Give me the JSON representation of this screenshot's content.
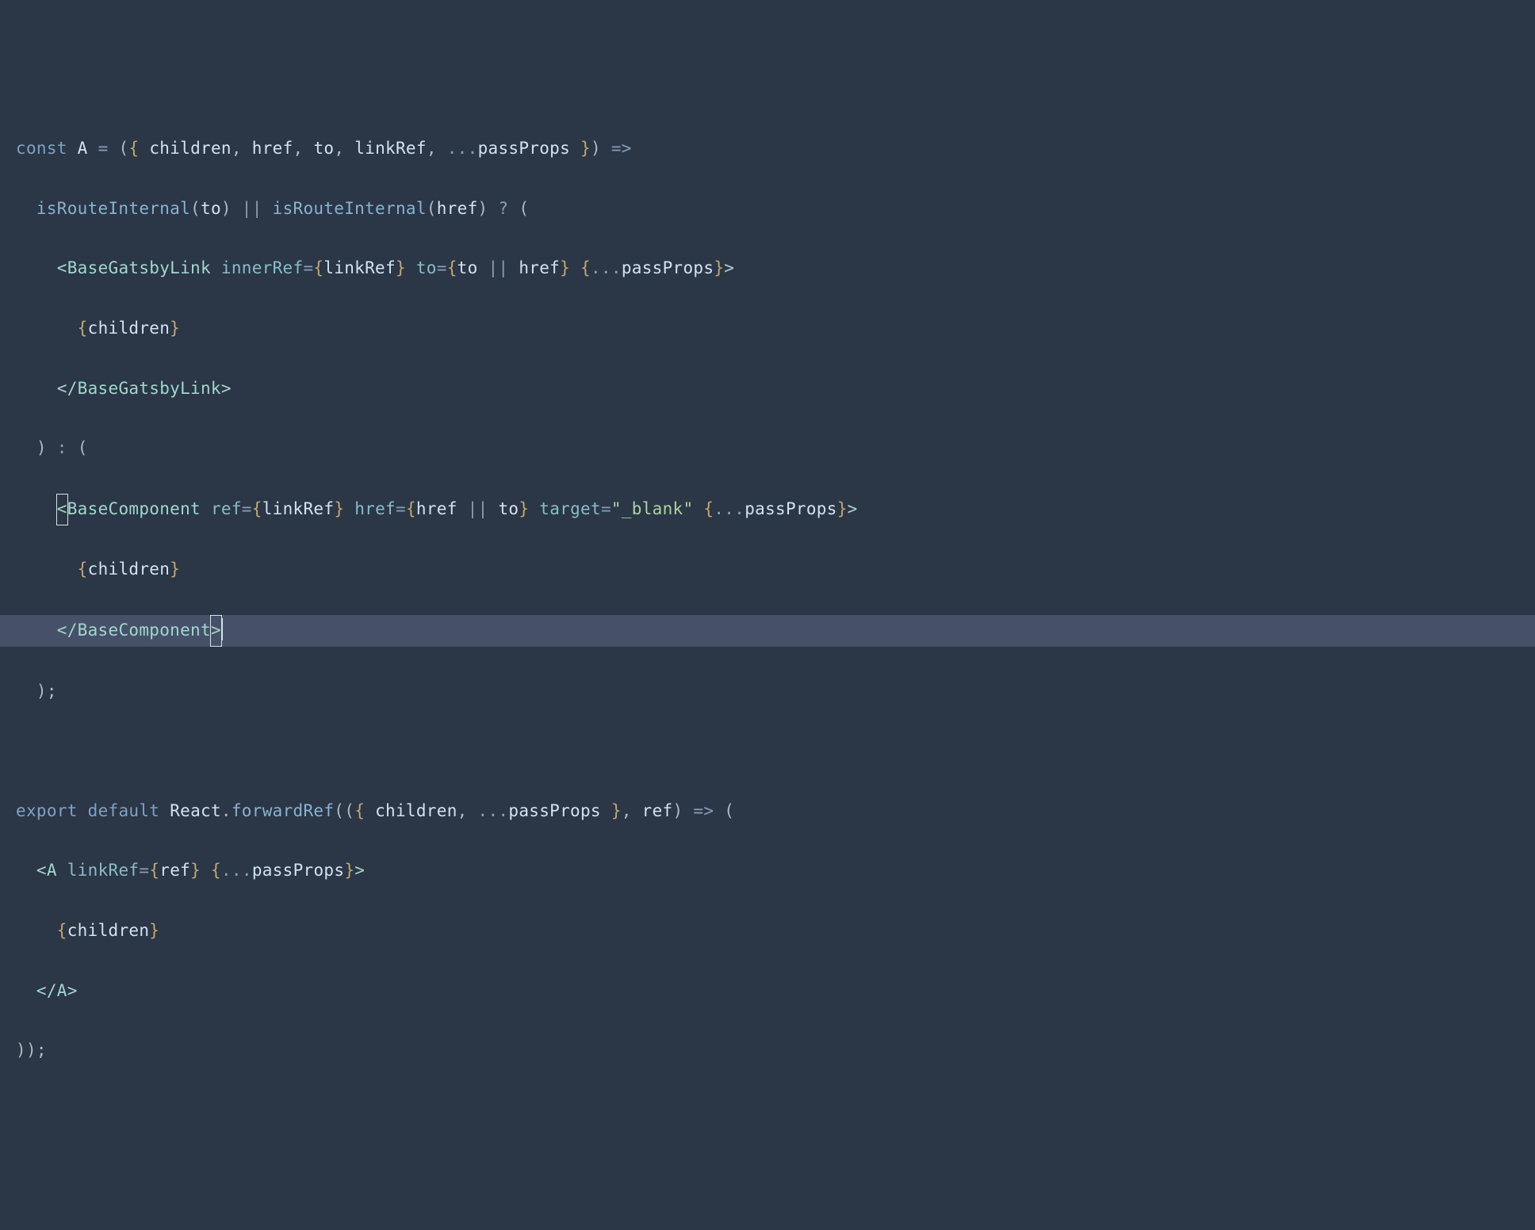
{
  "code": {
    "line1": {
      "kw_const": "const",
      "name_A": "A",
      "eq": "=",
      "oparen": "(",
      "obrace": "{ ",
      "p_children": "children",
      "comma1": ", ",
      "p_href": "href",
      "comma2": ", ",
      "p_to": "to",
      "comma3": ", ",
      "p_linkRef": "linkRef",
      "comma4": ", ",
      "spread": "...",
      "p_passProps": "passProps",
      "cbrace": " }",
      "cparen": ")",
      "arrow": " =>"
    },
    "line2": {
      "fn1": "isRouteInternal",
      "op": "(",
      "arg_to": "to",
      "cp": ")",
      "or": " || ",
      "fn2": "isRouteInternal",
      "op2": "(",
      "arg_href": "href",
      "cp2": ")",
      "tern_q": " ? ",
      "oparen": "("
    },
    "line3": {
      "lt": "<",
      "tag": "BaseGatsbyLink",
      "sp1": " ",
      "attr_innerRef": "innerRef",
      "eq1": "=",
      "ob1": "{",
      "val_linkRef": "linkRef",
      "cb1": "}",
      "sp2": " ",
      "attr_to": "to",
      "eq2": "=",
      "ob2": "{",
      "val_to": "to",
      "or": " || ",
      "val_href": "href",
      "cb2": "}",
      "sp3": " ",
      "ob3": "{",
      "spread": "...",
      "val_passProps": "passProps",
      "cb3": "}",
      "gt": ">"
    },
    "line4": {
      "ob": "{",
      "val": "children",
      "cb": "}"
    },
    "line5": {
      "lt": "</",
      "tag": "BaseGatsbyLink",
      "gt": ">"
    },
    "line6": {
      "cparen": ")",
      "colon": " : ",
      "oparen": "("
    },
    "line7": {
      "lt": "<",
      "tag": "BaseComponent",
      "sp1": " ",
      "attr_ref": "ref",
      "eq1": "=",
      "ob1": "{",
      "val_linkRef": "linkRef",
      "cb1": "}",
      "sp2": " ",
      "attr_href": "href",
      "eq2": "=",
      "ob2": "{",
      "val_href": "href",
      "or": " || ",
      "val_to": "to",
      "cb2": "}",
      "sp3": " ",
      "attr_target": "target",
      "eq3": "=",
      "str": "\"_blank\"",
      "sp4": " ",
      "ob3": "{",
      "spread": "...",
      "val_passProps": "passProps",
      "cb3": "}",
      "gt": ">"
    },
    "line8": {
      "ob": "{",
      "val": "children",
      "cb": "}"
    },
    "line9": {
      "lt": "</",
      "tag": "BaseComponent",
      "gt": ">"
    },
    "line10": {
      "cparen": ")",
      "semi": ";"
    },
    "line12": {
      "kw_export": "export",
      "sp1": " ",
      "kw_default": "default",
      "sp2": " ",
      "react": "React",
      "dot": ".",
      "forwardRef": "forwardRef",
      "op": "(",
      "op2": "(",
      "obrace": "{ ",
      "p_children": "children",
      "comma": ", ",
      "spread": "...",
      "p_passProps": "passProps",
      "cbrace": " }",
      "comma2": ", ",
      "p_ref": "ref",
      "cp": ")",
      "arrow": " => ",
      "oparen": "("
    },
    "line13": {
      "lt": "<",
      "tag": "A",
      "sp1": " ",
      "attr_linkRef": "linkRef",
      "eq1": "=",
      "ob1": "{",
      "val_ref": "ref",
      "cb1": "}",
      "sp2": " ",
      "ob2": "{",
      "spread": "...",
      "val_passProps": "passProps",
      "cb2": "}",
      "gt": ">"
    },
    "line14": {
      "ob": "{",
      "val": "children",
      "cb": "}"
    },
    "line15": {
      "lt": "</",
      "tag": "A",
      "gt": ">"
    },
    "line16": {
      "cp1": ")",
      "cp2": ")",
      "semi": ";"
    }
  }
}
